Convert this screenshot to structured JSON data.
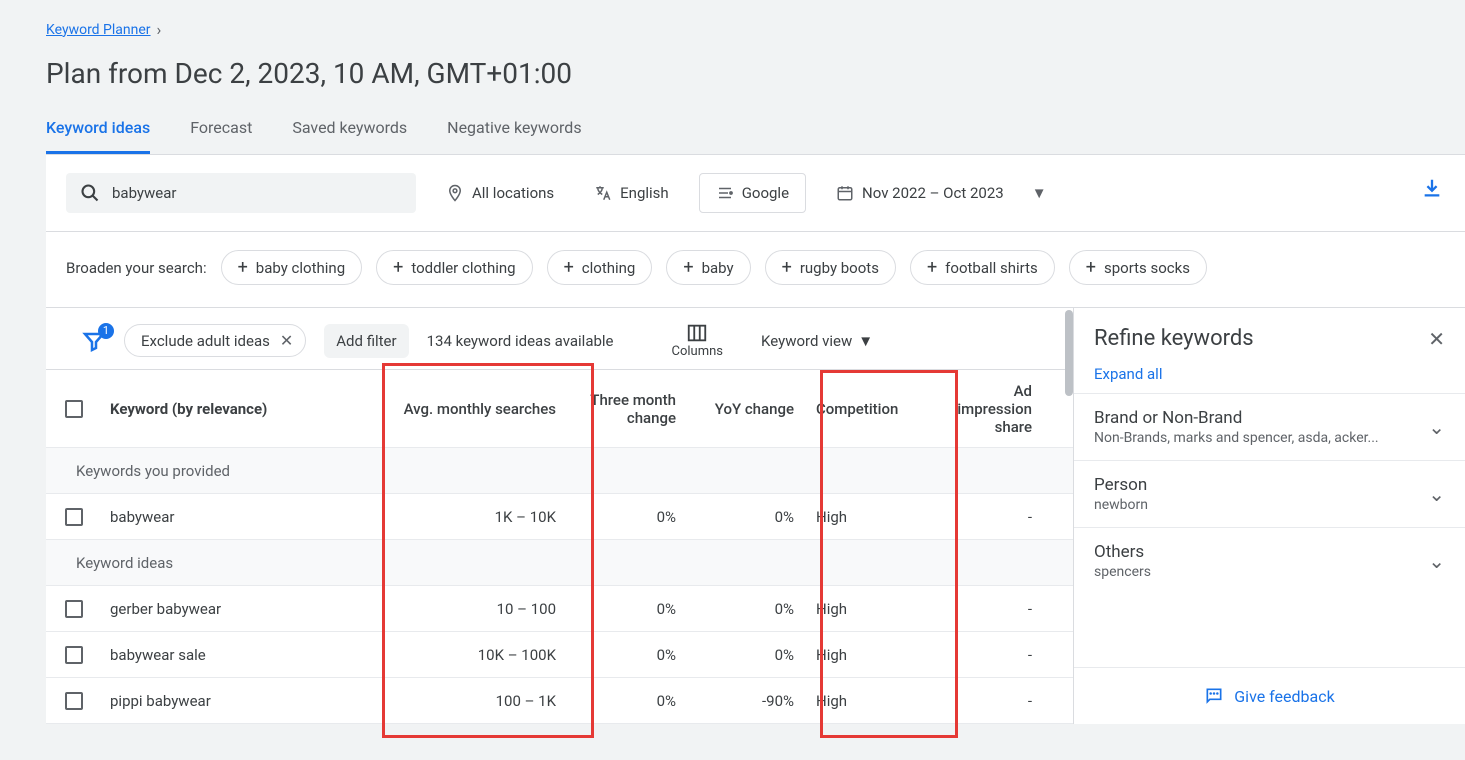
{
  "breadcrumb": {
    "label": "Keyword Planner"
  },
  "title": "Plan from Dec 2, 2023, 10 AM, GMT+01:00",
  "tabs": [
    {
      "label": "Keyword ideas",
      "active": true
    },
    {
      "label": "Forecast",
      "active": false
    },
    {
      "label": "Saved keywords",
      "active": false
    },
    {
      "label": "Negative keywords",
      "active": false
    }
  ],
  "search": {
    "query": "babywear"
  },
  "controls": {
    "locations": "All locations",
    "language": "English",
    "network": "Google",
    "date_range": "Nov 2022 – Oct 2023"
  },
  "broaden": {
    "label": "Broaden your search:",
    "chips": [
      "baby clothing",
      "toddler clothing",
      "clothing",
      "baby",
      "rugby boots",
      "football shirts",
      "sports socks"
    ]
  },
  "filter_bar": {
    "badge": "1",
    "active_filter": "Exclude adult ideas",
    "add_filter_label": "Add filter",
    "available_label": "134 keyword ideas available",
    "columns_label": "Columns",
    "view_label": "Keyword view"
  },
  "table": {
    "columns": {
      "keyword": "Keyword (by relevance)",
      "avg": "Avg. monthly searches",
      "three_mo": "Three month change",
      "yoy": "YoY change",
      "competition": "Competition",
      "impression": "Ad impression share"
    },
    "groups": [
      {
        "heading": "Keywords you provided",
        "rows": [
          {
            "keyword": "babywear",
            "avg": "1K – 10K",
            "three_mo": "0%",
            "yoy": "0%",
            "competition": "High",
            "impression": "-"
          }
        ]
      },
      {
        "heading": "Keyword ideas",
        "rows": [
          {
            "keyword": "gerber babywear",
            "avg": "10 – 100",
            "three_mo": "0%",
            "yoy": "0%",
            "competition": "High",
            "impression": "-"
          },
          {
            "keyword": "babywear sale",
            "avg": "10K – 100K",
            "three_mo": "0%",
            "yoy": "0%",
            "competition": "High",
            "impression": "-"
          },
          {
            "keyword": "pippi babywear",
            "avg": "100 – 1K",
            "three_mo": "0%",
            "yoy": "-90%",
            "competition": "High",
            "impression": "-"
          }
        ]
      }
    ]
  },
  "refine": {
    "title": "Refine keywords",
    "expand_all": "Expand all",
    "items": [
      {
        "title": "Brand or Non-Brand",
        "subtitle": "Non-Brands, marks and spencer, asda, acker..."
      },
      {
        "title": "Person",
        "subtitle": "newborn"
      },
      {
        "title": "Others",
        "subtitle": "spencers"
      }
    ],
    "feedback": "Give feedback"
  }
}
